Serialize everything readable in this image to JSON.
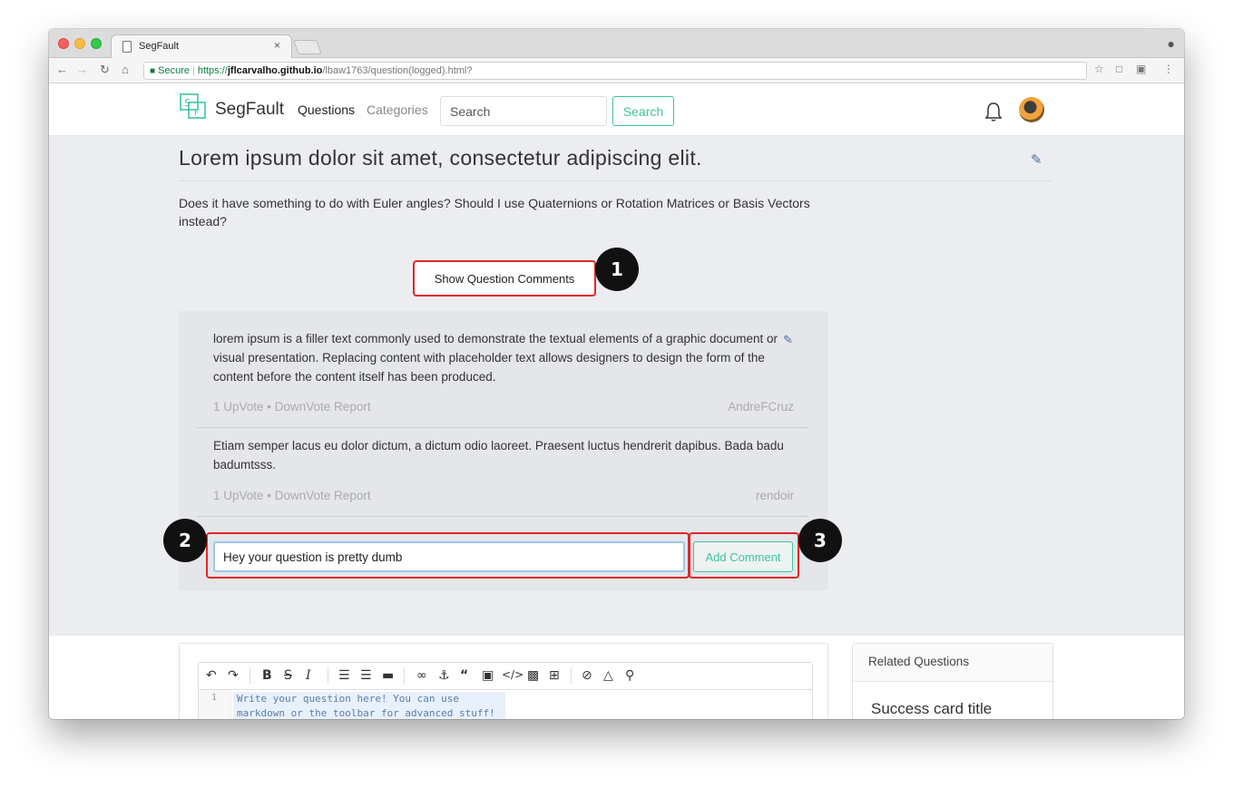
{
  "browser": {
    "tab_title": "SegFault",
    "tab_close": "×",
    "url_secure_label": "Secure",
    "url_scheme": "https://",
    "url_host": "jflcarvalho.github.io",
    "url_path": "/lbaw1763/question(logged).html?"
  },
  "nav": {
    "brand": "SegFault",
    "questions": "Questions",
    "categories": "Categories",
    "search_placeholder": "Search",
    "search_button": "Search"
  },
  "question": {
    "title": "Lorem ipsum dolor sit amet, consectetur adipiscing elit.",
    "body": "Does it have something to do with Euler angles? Should I use Quaternions or Rotation Matrices or Basis Vectors instead?",
    "show_comments": "Show Question Comments"
  },
  "comments": [
    {
      "text": "lorem ipsum is a filler text commonly used to demonstrate the textual elements of a graphic document or visual presentation. Replacing content with placeholder text allows designers to design the form of the content before the content itself has been produced.",
      "meta": "1 UpVote  •  DownVote  Report",
      "author": "AndreFCruz"
    },
    {
      "text": "Etiam semper lacus eu dolor dictum, a dictum odio laoreet. Praesent luctus hendrerit dapibus. Bada badu badumtsss.",
      "meta": "1 UpVote  •  DownVote  Report",
      "author": "rendoir"
    }
  ],
  "comment_form": {
    "value": "Hey your question is pretty dumb",
    "button": "Add Comment"
  },
  "badges": [
    "1",
    "2",
    "3"
  ],
  "editor": {
    "line_number": "1",
    "placeholder_text": "Write your question here! You can use markdown or the toolbar for advanced stuff!"
  },
  "sidebar": {
    "related_title": "Related Questions",
    "card_title": "Success card title"
  }
}
